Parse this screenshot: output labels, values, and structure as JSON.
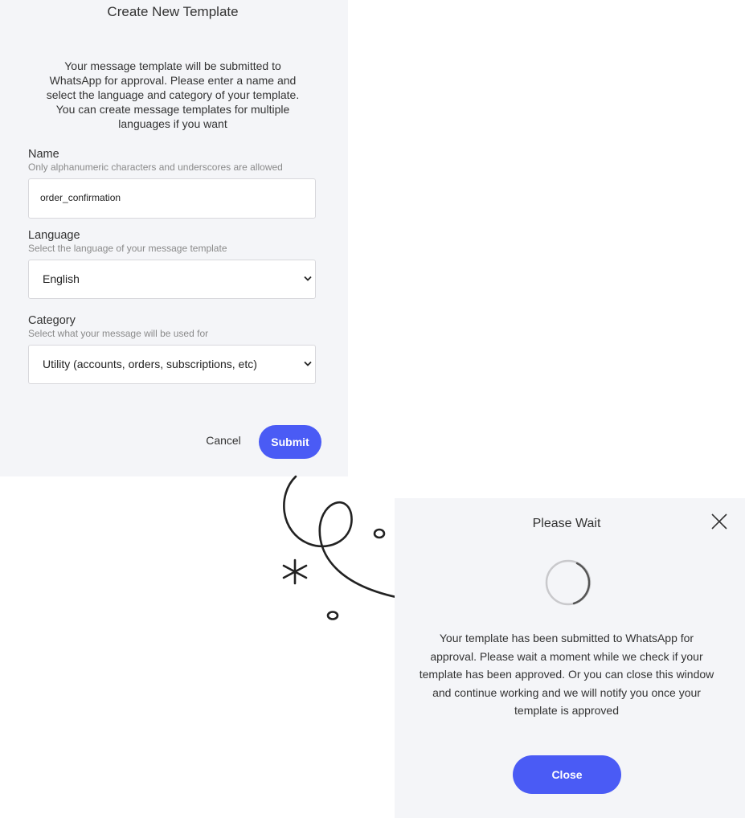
{
  "create_dialog": {
    "title": "Create New Template",
    "intro": "Your message template will be submitted to WhatsApp for approval. Please enter a name and select the language and category of your template. You can create message templates for multiple languages if you want",
    "name": {
      "label": "Name",
      "help": "Only alphanumeric characters and underscores are allowed",
      "value": "order_confirmation"
    },
    "language": {
      "label": "Language",
      "help": "Select the language of your message template",
      "selected": "English"
    },
    "category": {
      "label": "Category",
      "help": "Select what your message will be used for",
      "selected": "Utility (accounts, orders, subscriptions, etc)"
    },
    "cancel_label": "Cancel",
    "submit_label": "Submit"
  },
  "wait_dialog": {
    "title": "Please Wait",
    "message": "Your template has been submitted to WhatsApp for approval. Please wait a moment while we check if your template has been approved. Or you can close this window and continue working and we will notify you once your template is approved",
    "close_label": "Close",
    "close_icon": "close-icon",
    "spinner_icon": "loading-spinner-icon"
  },
  "colors": {
    "accent": "#4a5bf5",
    "panel_bg": "#f4f5f8",
    "text": "#333333",
    "muted": "#8a8a8a"
  },
  "icons": {
    "doodle": "curly-arrow-doodle",
    "select_arrow": "chevron-down-icon"
  }
}
